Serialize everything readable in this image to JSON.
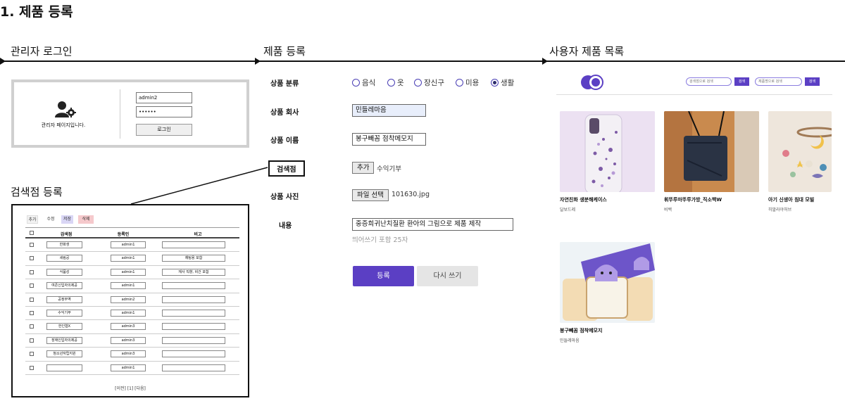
{
  "page_title": "1. 제품 등록",
  "sections": {
    "admin_login": "관리자 로그인",
    "product_register": "제품 등록",
    "user_products": "사용자 제품 목록",
    "store_register": "검색점 등록"
  },
  "login": {
    "id_value": "admin2",
    "password_value": "••••••",
    "button_label": "로그인",
    "caption": "관리자 페이지입니다."
  },
  "store": {
    "toolbar": [
      "추가",
      "수정",
      "저장",
      "삭제"
    ],
    "columns": [
      "검색점",
      "등록인",
      "비고"
    ],
    "rows": [
      {
        "store": "한화생",
        "registrant": "admin1",
        "note": ""
      },
      {
        "store": "세림공",
        "registrant": "admin1",
        "note": "채팅용 포함"
      },
      {
        "store": "식품성",
        "registrant": "admin1",
        "note": "재사 직향, 비건 포함"
      },
      {
        "store": "여존신입자의제공",
        "registrant": "admin1",
        "note": ""
      },
      {
        "store": "공정무역",
        "registrant": "admin2",
        "note": ""
      },
      {
        "store": "수익기부",
        "registrant": "admin1",
        "note": ""
      },
      {
        "store": "한인협X",
        "registrant": "admin3",
        "note": ""
      },
      {
        "store": "장애인입자의제공",
        "registrant": "admin3",
        "note": ""
      },
      {
        "store": "청소년자립지원",
        "registrant": "admin3",
        "note": ""
      },
      {
        "store": "",
        "registrant": "admin1",
        "note": ""
      }
    ],
    "pager": "[이전]  [1]  [다음]"
  },
  "form": {
    "labels": {
      "category": "상품 분류",
      "company": "상품 회사",
      "name": "상품 이름",
      "store": "검색점",
      "photo": "상품 사진",
      "content": "내용"
    },
    "categories": [
      {
        "label": "음식",
        "selected": false
      },
      {
        "label": "옷",
        "selected": false
      },
      {
        "label": "장신구",
        "selected": false
      },
      {
        "label": "미용",
        "selected": false
      },
      {
        "label": "생활",
        "selected": true
      }
    ],
    "company_value": "민들레마음",
    "name_value": "봉구빼꼼 점착메모지",
    "store_add_button": "추가",
    "store_value": "수익기부",
    "file_button": "파일 선택",
    "file_name": "101630.jpg",
    "content_value": "중증희귀난치질환 환아의 그림으로 제품 제작",
    "content_hint": "띄어쓰기 포함 25자",
    "submit_label": "등록",
    "reset_label": "다시 쓰기"
  },
  "user_list": {
    "search_placeholder_1": "검색점으로 검색",
    "search_button_1": "검색",
    "search_placeholder_2": "제품명으로 검색",
    "search_button_2": "검색",
    "products": [
      {
        "name": "자연친화 생분해케이스",
        "maker": "달보드레"
      },
      {
        "name": "휘뚜루마뚜루가방_직소백W",
        "maker": "비백"
      },
      {
        "name": "아기 신생아 침대 모빌",
        "maker": "히말라야허브"
      },
      {
        "name": "봉구빼꼼 점착메모지",
        "maker": "민들레마음"
      }
    ]
  },
  "colors": {
    "accent": "#5b3fc4",
    "radio": "#4a3fb5"
  }
}
